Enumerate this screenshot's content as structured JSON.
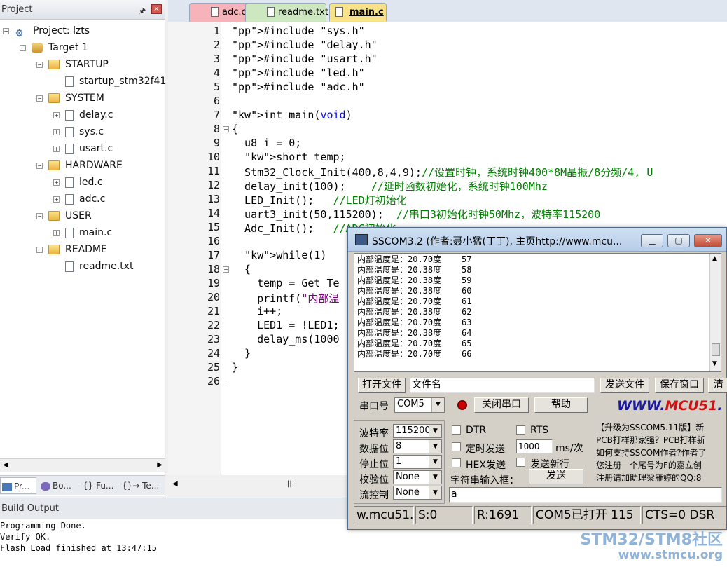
{
  "project": {
    "title": "Project",
    "tree": [
      {
        "label": "Project: lzts",
        "kind": "project",
        "toggle": "-",
        "depth": 0
      },
      {
        "label": "Target 1",
        "kind": "target",
        "toggle": "-",
        "depth": 1
      },
      {
        "label": "STARTUP",
        "kind": "folder",
        "toggle": "-",
        "depth": 2
      },
      {
        "label": "startup_stm32f41",
        "kind": "file",
        "toggle": "",
        "depth": 3
      },
      {
        "label": "SYSTEM",
        "kind": "folder",
        "toggle": "-",
        "depth": 2
      },
      {
        "label": "delay.c",
        "kind": "file",
        "toggle": "+",
        "depth": 3
      },
      {
        "label": "sys.c",
        "kind": "file",
        "toggle": "+",
        "depth": 3
      },
      {
        "label": "usart.c",
        "kind": "file",
        "toggle": "+",
        "depth": 3
      },
      {
        "label": "HARDWARE",
        "kind": "folder",
        "toggle": "-",
        "depth": 2
      },
      {
        "label": "led.c",
        "kind": "file",
        "toggle": "+",
        "depth": 3
      },
      {
        "label": "adc.c",
        "kind": "file",
        "toggle": "+",
        "depth": 3
      },
      {
        "label": "USER",
        "kind": "folder",
        "toggle": "-",
        "depth": 2
      },
      {
        "label": "main.c",
        "kind": "file",
        "toggle": "+",
        "depth": 3
      },
      {
        "label": "README",
        "kind": "folder",
        "toggle": "-",
        "depth": 2
      },
      {
        "label": "readme.txt",
        "kind": "file",
        "toggle": "",
        "depth": 3
      }
    ],
    "bottom_tabs": [
      "Pr...",
      "Bo...",
      "{} Fu...",
      "{}→ Te..."
    ]
  },
  "editor": {
    "tabs": [
      {
        "label": "adc.c",
        "active": false,
        "color": "#f6b3ba"
      },
      {
        "label": "readme.txt",
        "active": false,
        "color": "#cde8c1"
      },
      {
        "label": "main.c",
        "active": true,
        "color": "#f7e28a"
      }
    ],
    "lines": [
      {
        "n": "1",
        "text": "#include \"sys.h\"",
        "fold": ""
      },
      {
        "n": "2",
        "text": "#include \"delay.h\"",
        "fold": ""
      },
      {
        "n": "3",
        "text": "#include \"usart.h\"",
        "fold": ""
      },
      {
        "n": "4",
        "text": "#include \"led.h\"",
        "fold": ""
      },
      {
        "n": "5",
        "text": "#include \"adc.h\"",
        "fold": ""
      },
      {
        "n": "6",
        "text": "",
        "fold": ""
      },
      {
        "n": "7",
        "text": "int main(void)",
        "fold": ""
      },
      {
        "n": "8",
        "text": "{",
        "fold": "-"
      },
      {
        "n": "9",
        "text": "  u8 i = 0;",
        "fold": ""
      },
      {
        "n": "10",
        "text": "  short temp;",
        "fold": ""
      },
      {
        "n": "11",
        "text": "  Stm32_Clock_Init(400,8,4,9);//设置时钟，系统时钟400*8M晶振/8分频/4, U",
        "fold": ""
      },
      {
        "n": "12",
        "text": "  delay_init(100);    //延时函数初始化，系统时钟100Mhz",
        "fold": ""
      },
      {
        "n": "13",
        "text": "  LED_Init();   //LED灯初始化",
        "fold": ""
      },
      {
        "n": "14",
        "text": "  uart3_init(50,115200);  //串口3初始化时钟50Mhz，波特率115200",
        "fold": ""
      },
      {
        "n": "15",
        "text": "  Adc_Init();   //ADC初始化",
        "fold": ""
      },
      {
        "n": "16",
        "text": "",
        "fold": ""
      },
      {
        "n": "17",
        "text": "  while(1)",
        "fold": ""
      },
      {
        "n": "18",
        "text": "  {",
        "fold": "-"
      },
      {
        "n": "19",
        "text": "    temp = Get_Te",
        "fold": ""
      },
      {
        "n": "20",
        "text": "    printf(\"内部温",
        "fold": ""
      },
      {
        "n": "21",
        "text": "    i++;",
        "fold": ""
      },
      {
        "n": "22",
        "text": "    LED1 = !LED1;",
        "fold": ""
      },
      {
        "n": "23",
        "text": "    delay_ms(1000",
        "fold": ""
      },
      {
        "n": "24",
        "text": "  }",
        "fold": ""
      },
      {
        "n": "25",
        "text": "}",
        "fold": ""
      },
      {
        "n": "26",
        "text": "",
        "fold": ""
      }
    ]
  },
  "build": {
    "title": "Build Output",
    "lines": [
      "Programming Done.",
      "Verify OK.",
      "Flash Load finished at 13:47:15"
    ]
  },
  "sscom": {
    "title": "SSCOM3.2 (作者:聂小猛(丁丁), 主页http://www.mcu...",
    "recv_lines": [
      "内部温度是：20.70度    57",
      "内部温度是：20.38度    58",
      "内部温度是：20.38度    59",
      "内部温度是：20.38度    60",
      "内部温度是：20.70度    61",
      "内部温度是：20.38度    62",
      "内部温度是：20.70度    63",
      "内部温度是：20.38度    64",
      "内部温度是：20.70度    65",
      "内部温度是：20.70度    66"
    ],
    "open_file": "打开文件",
    "filename": "文件名",
    "send_file": "发送文件",
    "save_window": "保存窗口",
    "clear": "清",
    "port_label": "串口号",
    "port_value": "COM5",
    "close_port": "关闭串口",
    "help": "帮助",
    "brand_www": "WWW.",
    "brand_mcu51": "MCU51",
    "brand_tail": ".",
    "baud_label": "波特率",
    "baud_value": "115200",
    "databits_label": "数据位",
    "databits_value": "8",
    "stopbits_label": "停止位",
    "stopbits_value": "1",
    "parity_label": "校验位",
    "parity_value": "None",
    "flow_label": "流控制",
    "flow_value": "None",
    "dtr": "DTR",
    "rts": "RTS",
    "timed_send": "定时发送",
    "interval_value": "1000",
    "interval_unit": "ms/次",
    "hex_send": "HEX发送",
    "send_newline": "发送新行",
    "string_input_label": "字符串输入框：",
    "send": "发送",
    "input_value": "a",
    "promo_lines": [
      "【升级为SSCOM5.11版】新",
      "PCB打样那家强？PCB打样新",
      "如何支持SSCOM作者?作者了",
      "您注册一个尾号为F的嘉立创",
      "注册请加助理梁雁婷的QQ:8"
    ],
    "status": [
      "w.mcu51.c",
      "S:0",
      "R:1691",
      "COM5已打开 115",
      "CTS=0 DSR"
    ]
  },
  "watermark": {
    "line1": "STM32/STM8社区",
    "line2": "www.stmcu.org"
  }
}
